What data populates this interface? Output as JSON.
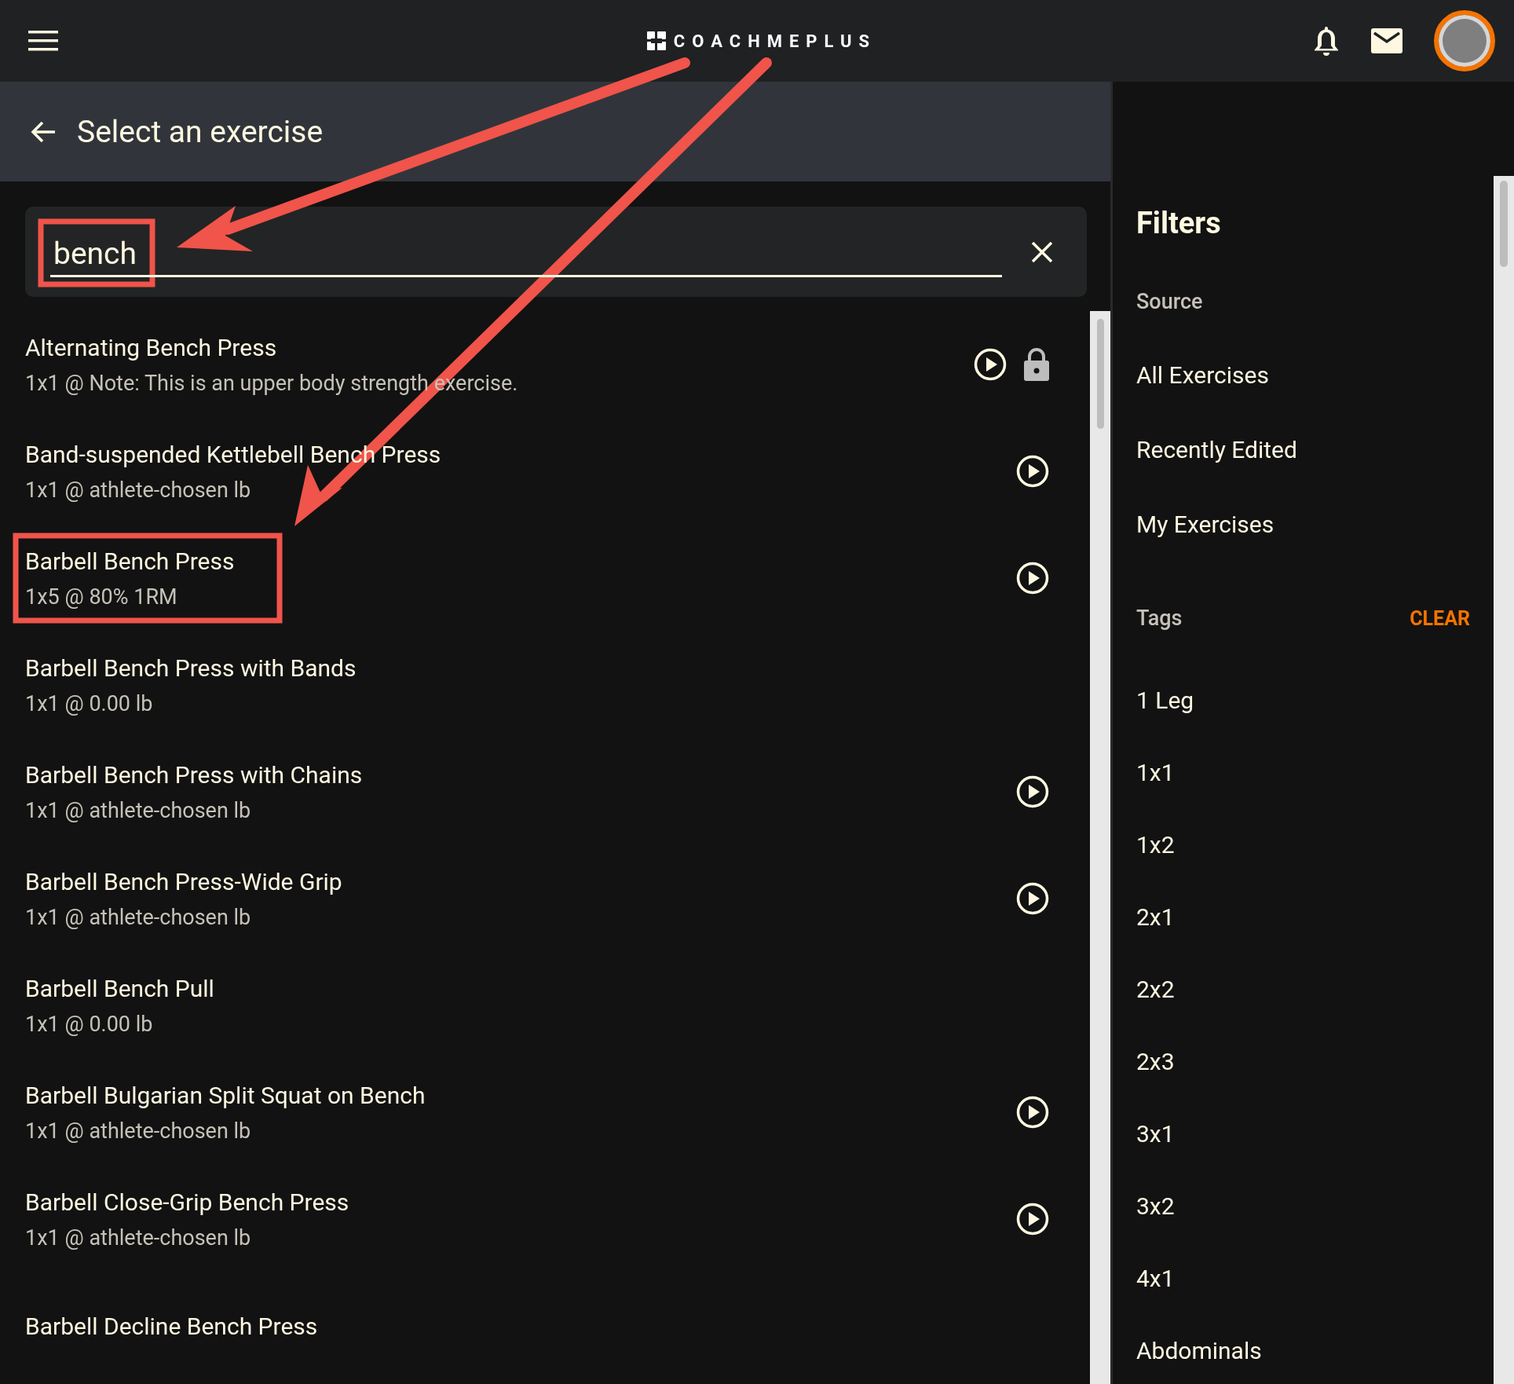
{
  "top_bar": {
    "logo": "COACHMEPLUS"
  },
  "page_header": {
    "title": "Select an exercise"
  },
  "search": {
    "value": "bench"
  },
  "exercises": [
    {
      "name": "Alternating Bench Press",
      "detail": "1x1 @ Note: This is an upper body strength exercise.",
      "video": true,
      "locked": true
    },
    {
      "name": "Band-suspended Kettlebell Bench Press",
      "detail": "1x1 @ athlete-chosen lb",
      "video": true,
      "locked": false
    },
    {
      "name": "Barbell Bench Press",
      "detail": "1x5 @ 80% 1RM",
      "video": true,
      "locked": false
    },
    {
      "name": "Barbell Bench Press with Bands",
      "detail": "1x1 @ 0.00 lb",
      "video": false,
      "locked": false
    },
    {
      "name": "Barbell Bench Press with Chains",
      "detail": "1x1 @ athlete-chosen lb",
      "video": true,
      "locked": false
    },
    {
      "name": "Barbell Bench Press-Wide Grip",
      "detail": "1x1 @ athlete-chosen lb",
      "video": true,
      "locked": false
    },
    {
      "name": "Barbell Bench Pull",
      "detail": "1x1 @ 0.00 lb",
      "video": false,
      "locked": false
    },
    {
      "name": "Barbell Bulgarian Split Squat on Bench",
      "detail": "1x1 @ athlete-chosen lb",
      "video": true,
      "locked": false
    },
    {
      "name": "Barbell Close-Grip Bench Press",
      "detail": "1x1 @ athlete-chosen lb",
      "video": true,
      "locked": false
    },
    {
      "name": "Barbell Decline Bench Press",
      "video": false,
      "locked": false
    }
  ],
  "filters": {
    "title": "Filters",
    "source_label": "Source",
    "sources": [
      "All Exercises",
      "Recently Edited",
      "My Exercises"
    ],
    "tags_label": "Tags",
    "clear": "CLEAR",
    "tags": [
      "1 Leg",
      "1x1",
      "1x2",
      "2x1",
      "2x2",
      "2x3",
      "3x1",
      "3x2",
      "4x1",
      "Abdominals"
    ]
  }
}
